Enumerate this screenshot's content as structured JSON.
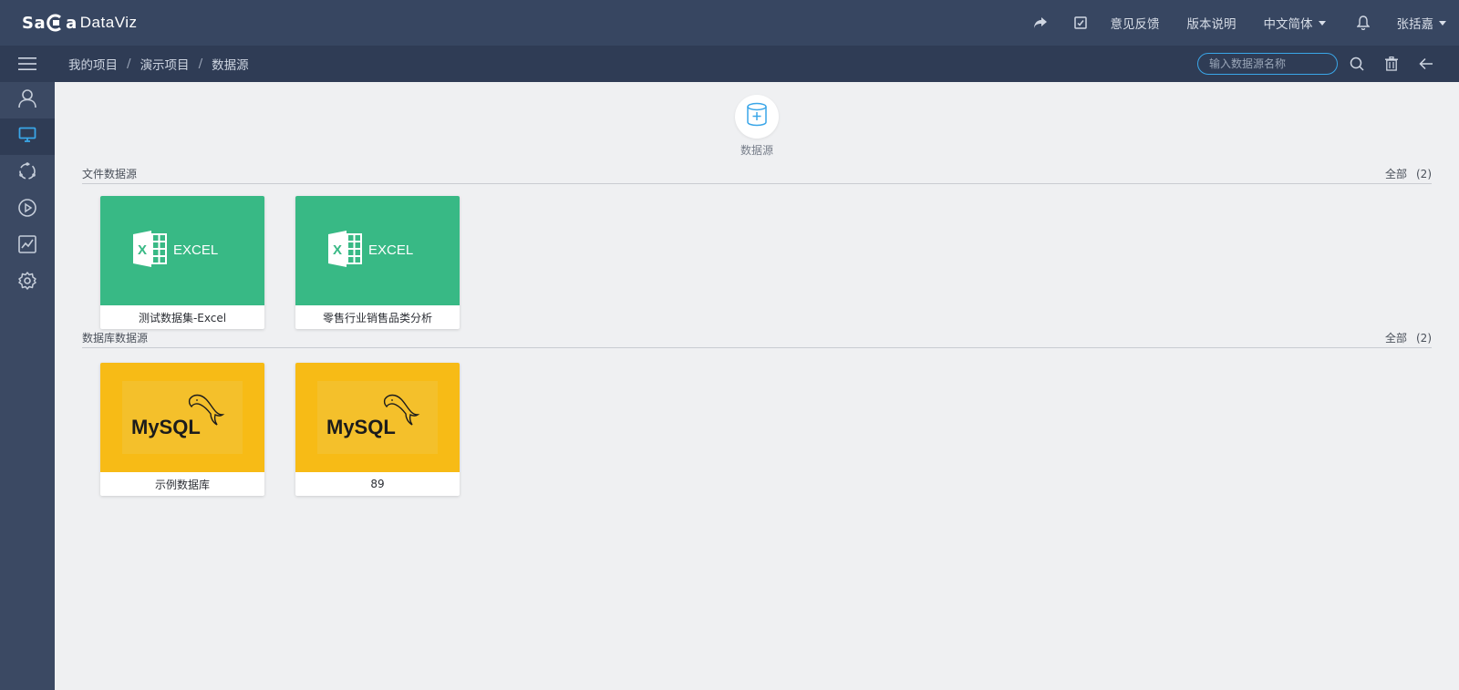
{
  "brand": {
    "part1": "Sa",
    "part2": "a",
    "part3": "DataViz"
  },
  "topbar": {
    "share_icon": "share-icon",
    "checkbox_icon": "checklist-icon",
    "feedback": "意见反馈",
    "release_notes": "版本说明",
    "language": "中文简体",
    "bell_icon": "bell-icon",
    "user": "张括嘉"
  },
  "breadcrumb": [
    "我的项目",
    "演示项目",
    "数据源"
  ],
  "breadcrumb_separator": "/",
  "search": {
    "placeholder": "输入数据源名称"
  },
  "sidebar": [
    "user-icon",
    "monitor-icon",
    "cycle-icon",
    "play-icon",
    "chart-icon",
    "settings-icon"
  ],
  "add_datasource": {
    "label": "数据源"
  },
  "sections": {
    "file": {
      "title": "文件数据源",
      "all_label": "全部",
      "count": "(2)",
      "items": [
        {
          "label": "测试数据集-Excel",
          "type": "EXCEL"
        },
        {
          "label": "零售行业销售品类分析",
          "type": "EXCEL"
        }
      ]
    },
    "db": {
      "title": "数据库数据源",
      "all_label": "全部",
      "count": "(2)",
      "items": [
        {
          "label": "示例数据库",
          "type": "MySQL"
        },
        {
          "label": "89",
          "type": "MySQL"
        }
      ]
    }
  },
  "colors": {
    "topbar": "#374661",
    "subbar": "#2f3c55",
    "sidebar": "#3b4963",
    "accent": "#3aa6e8",
    "excel": "#38b985",
    "mysql": "#f7bb16"
  }
}
